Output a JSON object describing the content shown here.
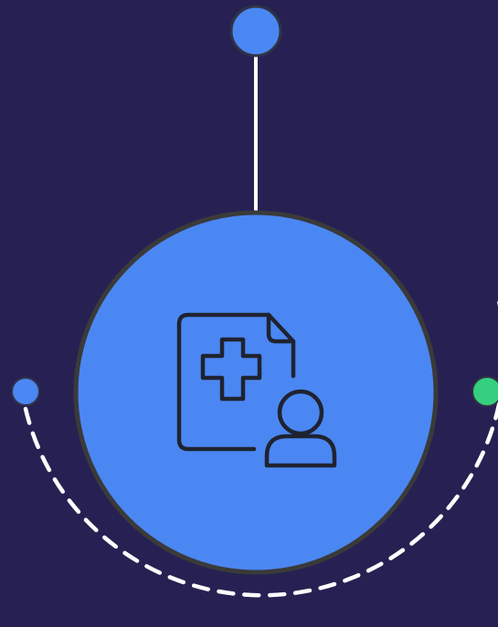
{
  "diagram": {
    "nodes": [
      {
        "role": "top-node",
        "shape": "circle",
        "color": "#4B87F2"
      },
      {
        "role": "central-hub",
        "shape": "circle",
        "color": "#4B87F2",
        "icon": "medical-record-patient-icon"
      },
      {
        "role": "left-node",
        "shape": "circle",
        "color": "#4B87F2"
      },
      {
        "role": "right-node",
        "shape": "circle",
        "color": "#35D07F"
      }
    ],
    "connectors": [
      {
        "from": "top-node",
        "to": "central-hub",
        "style": "solid",
        "color": "#FFFFFF"
      },
      {
        "from": "left-node",
        "to": "right-node",
        "style": "dashed",
        "color": "#FFFFFF",
        "shape": "arc"
      }
    ]
  },
  "colors": {
    "background": "#262152",
    "hub": "#4B87F2",
    "hub_outline": "#3A3A3A",
    "icon_stroke": "#1F2330",
    "accent_green": "#35D07F"
  }
}
